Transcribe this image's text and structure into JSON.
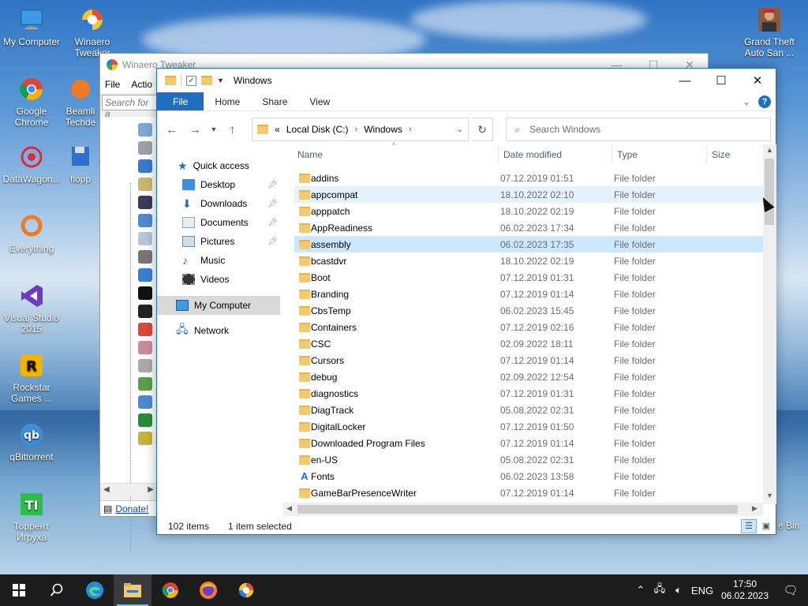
{
  "desktop": {
    "icons": [
      {
        "label": "My Computer",
        "icon": "computer-icon"
      },
      {
        "label": "Winaero Tweaker",
        "icon": "winaero-icon"
      },
      {
        "label": "Google Chrome",
        "icon": "chrome-icon"
      },
      {
        "label": "Beamli Techde",
        "icon": "beam-icon"
      },
      {
        "label": "DataWagon...",
        "icon": "datawagon-icon"
      },
      {
        "label": "flopp",
        "icon": "floppy-icon"
      },
      {
        "label": "Everything",
        "icon": "everything-icon"
      },
      {
        "label": "Visual Studio 2015",
        "icon": "visual-studio-icon"
      },
      {
        "label": "Rockstar Games ...",
        "icon": "rockstar-icon"
      },
      {
        "label": "qBittorrent",
        "icon": "qbittorrent-icon"
      },
      {
        "label": "Торрент Игруха",
        "icon": "torrent-igruha-icon"
      },
      {
        "label": "Grand Theft Auto San ...",
        "icon": "gta-icon"
      }
    ],
    "recycle_bin_partial": "e Bin"
  },
  "winaero": {
    "title": "Winaero Tweaker",
    "menu": [
      "File",
      "Actio"
    ],
    "search_placeholder": "Search for a",
    "donate": "Donate!",
    "controls": [
      "—",
      "☐",
      "✕"
    ]
  },
  "explorer": {
    "title": "Windows",
    "controls": [
      "—",
      "☐",
      "✕"
    ],
    "ribbon_tabs": [
      "File",
      "Home",
      "Share",
      "View"
    ],
    "breadcrumb": [
      "Local Disk (C:)",
      "Windows"
    ],
    "breadcrumb_overflow": "«",
    "search_placeholder": "Search Windows",
    "nav": {
      "quick_access": "Quick access",
      "pinned": [
        "Desktop",
        "Downloads",
        "Documents",
        "Pictures"
      ],
      "unpinned": [
        "Music",
        "Videos"
      ],
      "this_pc": "My Computer",
      "network": "Network"
    },
    "columns": [
      "Name",
      "Date modified",
      "Type",
      "Size"
    ],
    "files": [
      {
        "name": "addins",
        "date": "07.12.2019 01:51",
        "type": "File folder"
      },
      {
        "name": "appcompat",
        "date": "18.10.2022 02:10",
        "type": "File folder"
      },
      {
        "name": "apppatch",
        "date": "18.10.2022 02:19",
        "type": "File folder"
      },
      {
        "name": "AppReadiness",
        "date": "06.02.2023 17:34",
        "type": "File folder"
      },
      {
        "name": "assembly",
        "date": "06.02.2023 17:35",
        "type": "File folder"
      },
      {
        "name": "bcastdvr",
        "date": "18.10.2022 02:19",
        "type": "File folder"
      },
      {
        "name": "Boot",
        "date": "07.12.2019 01:31",
        "type": "File folder"
      },
      {
        "name": "Branding",
        "date": "07.12.2019 01:14",
        "type": "File folder"
      },
      {
        "name": "CbsTemp",
        "date": "06.02.2023 15:45",
        "type": "File folder"
      },
      {
        "name": "Containers",
        "date": "07.12.2019 02:16",
        "type": "File folder"
      },
      {
        "name": "CSC",
        "date": "02.09.2022 18:11",
        "type": "File folder"
      },
      {
        "name": "Cursors",
        "date": "07.12.2019 01:14",
        "type": "File folder"
      },
      {
        "name": "debug",
        "date": "02.09.2022 12:54",
        "type": "File folder"
      },
      {
        "name": "diagnostics",
        "date": "07.12.2019 01:31",
        "type": "File folder"
      },
      {
        "name": "DiagTrack",
        "date": "05.08.2022 02:31",
        "type": "File folder"
      },
      {
        "name": "DigitalLocker",
        "date": "07.12.2019 01:50",
        "type": "File folder"
      },
      {
        "name": "Downloaded Program Files",
        "date": "07.12.2019 01:14",
        "type": "File folder"
      },
      {
        "name": "en-US",
        "date": "05.08.2022 02:31",
        "type": "File folder"
      },
      {
        "name": "Fonts",
        "date": "06.02.2023 13:58",
        "type": "File folder"
      },
      {
        "name": "GameBarPresenceWriter",
        "date": "07.12.2019 01:14",
        "type": "File folder"
      }
    ],
    "selected_index": 4,
    "hover_index": 1,
    "status": {
      "items": "102 items",
      "selected": "1 item selected"
    }
  },
  "taskbar": {
    "apps": [
      "start-icon",
      "search-icon",
      "edge-icon",
      "file-explorer-icon",
      "chrome-icon",
      "firefox-icon",
      "winaero-icon"
    ],
    "active_app": "file-explorer-icon",
    "language": "ENG",
    "time": "17:50",
    "date": "06.02.2023"
  },
  "colors": {
    "accent": "#1e6fbf",
    "selection": "#cce8ff",
    "hover": "#e5f3ff",
    "folder": "#f3c96a",
    "taskbar": "#1c1c1c"
  }
}
